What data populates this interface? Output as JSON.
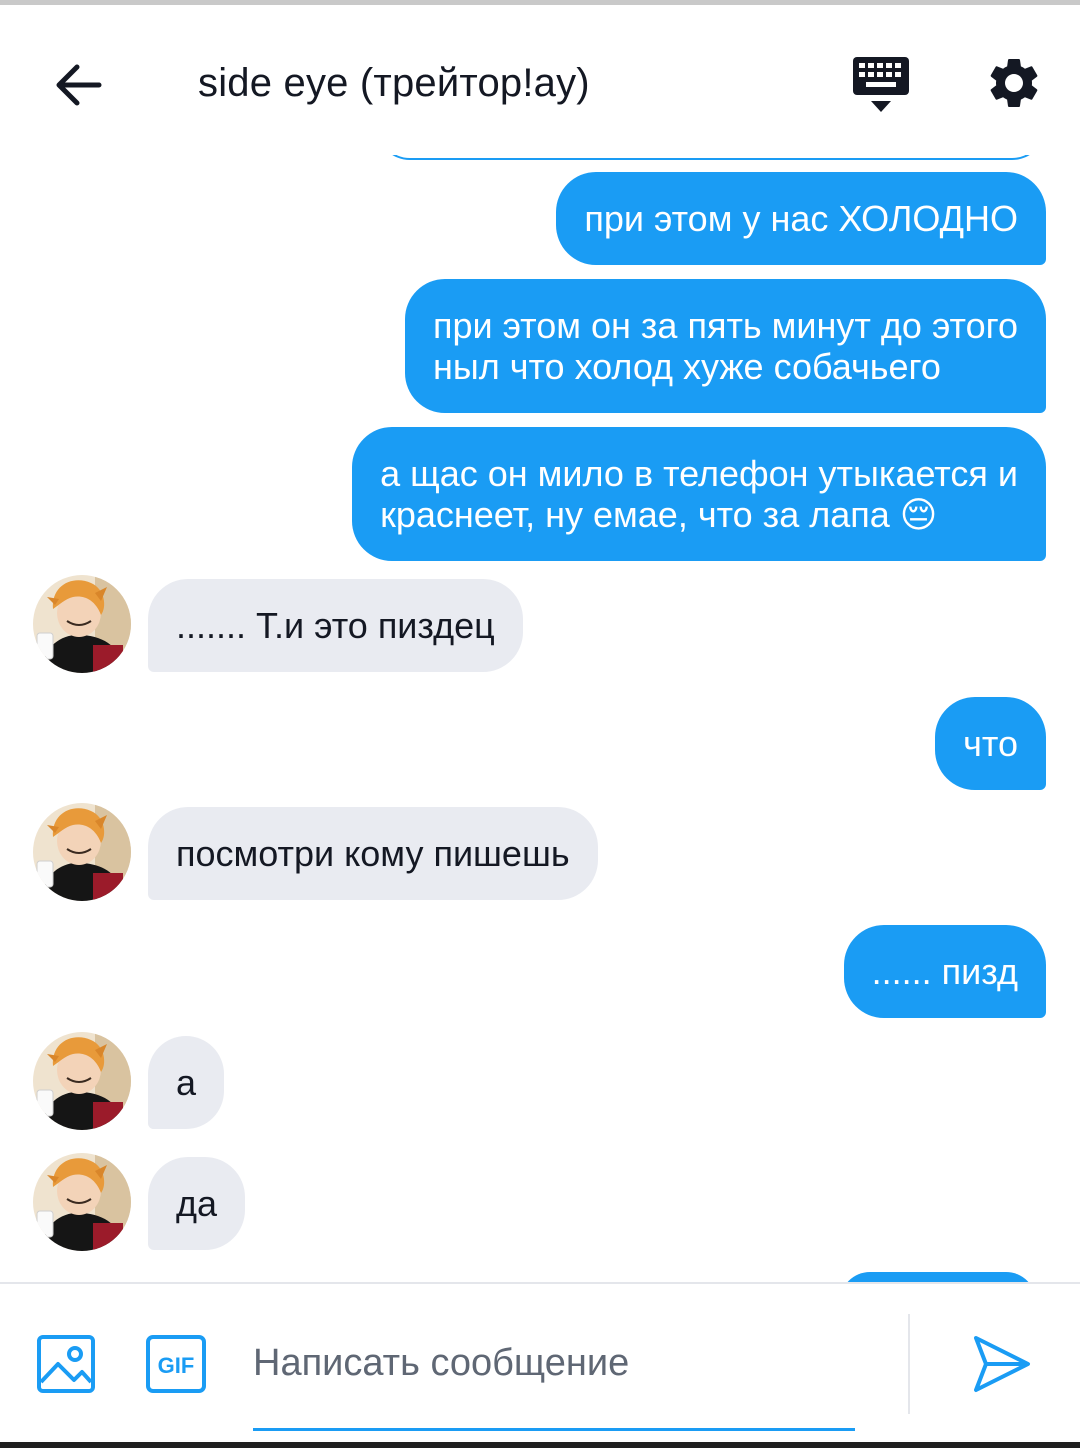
{
  "header": {
    "title": "side eye (трейтор!ay)",
    "back_icon": "arrow-left-icon",
    "keyboard_icon": "keyboard-hide-icon",
    "settings_icon": "gear-icon"
  },
  "colors": {
    "accent": "#1a9cf4",
    "incoming_bubble": "#e9ebf1",
    "text": "#141823"
  },
  "messages": [
    {
      "direction": "out",
      "text": "при этом у нас ХОЛОДНО"
    },
    {
      "direction": "out",
      "lines": [
        "при этом он за пять минут до этого",
        "ныл что холод хуже собачьего"
      ]
    },
    {
      "direction": "out",
      "lines": [
        "а щас он мило в телефон утыкается и",
        "краснеет, ну емае, что за лапа"
      ],
      "emoji": "😔"
    },
    {
      "direction": "in",
      "text": "....... Т.и это пиздец"
    },
    {
      "direction": "out",
      "text": "что"
    },
    {
      "direction": "in",
      "text": "посмотри кому пишешь"
    },
    {
      "direction": "out",
      "text": "...... пизд"
    },
    {
      "direction": "in",
      "text": "а"
    },
    {
      "direction": "in",
      "text": "да"
    }
  ],
  "composer": {
    "placeholder": "Написать сообщение",
    "value": "",
    "image_icon": "image-icon",
    "gif_label": "GIF",
    "send_icon": "send-icon"
  }
}
